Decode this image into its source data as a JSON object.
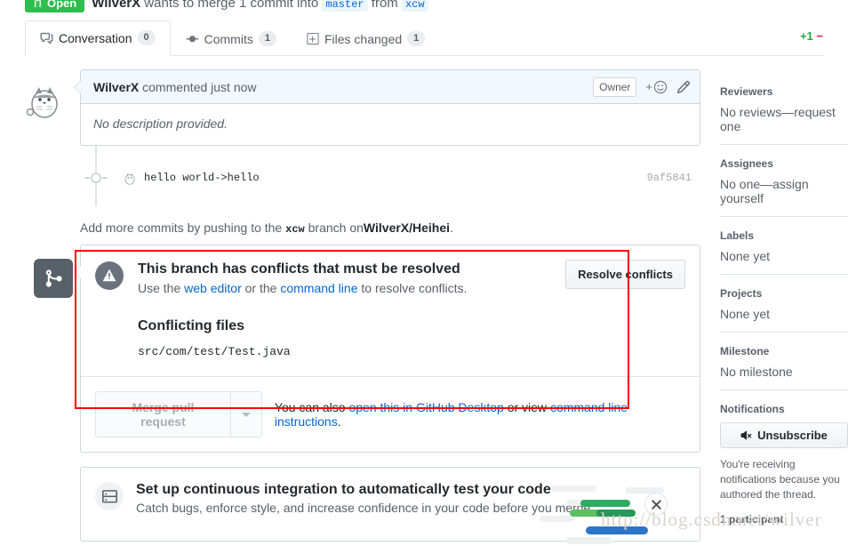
{
  "header": {
    "state": "Open",
    "author": "WilverX",
    "text_wants": "wants to merge",
    "commit_count": "1 commit",
    "into_word": "into",
    "base_branch": "master",
    "from_word": "from",
    "head_branch": "xcw"
  },
  "tabs": [
    {
      "label": "Conversation",
      "count": "0",
      "icon": "comment-discussion-icon",
      "active": true
    },
    {
      "label": "Commits",
      "count": "1",
      "icon": "git-commit-icon",
      "active": false
    },
    {
      "label": "Files changed",
      "count": "1",
      "icon": "diff-icon",
      "active": false
    }
  ],
  "diffstat": {
    "additions": "+1",
    "deletions": "−"
  },
  "comment": {
    "author": "WilverX",
    "action": "commented just now",
    "owner_badge": "Owner",
    "add_reaction": "+",
    "body": "No description provided."
  },
  "commit": {
    "message": "hello world->hello",
    "sha": "9af5841"
  },
  "add_more": {
    "prefix": "Add more commits by pushing to the",
    "branch": "xcw",
    "middle": "branch on",
    "repo": "WilverX/Heihei",
    "suffix": "."
  },
  "conflicts": {
    "title": "This branch has conflicts that must be resolved",
    "sub_prefix": "Use the",
    "link_web_editor": "web editor",
    "sub_middle": "or the",
    "link_command_line": "command line",
    "sub_suffix": "to resolve conflicts.",
    "resolve_button": "Resolve conflicts",
    "files_heading": "Conflicting files",
    "files": [
      "src/com/test/Test.java"
    ]
  },
  "merge": {
    "button_label": "Merge pull request",
    "note_prefix": "You can also",
    "link_desktop": "open this in GitHub Desktop",
    "note_middle": "or view",
    "link_cli": "command line instructions",
    "note_suffix": "."
  },
  "ci_promo": {
    "title": "Set up continuous integration to automatically test your code",
    "subtitle": "Catch bugs, enforce style, and increase confidence in your code before you merge.",
    "dismiss": "✕"
  },
  "sidebar": [
    {
      "title": "Reviewers",
      "value": "No reviews—request one"
    },
    {
      "title": "Assignees",
      "value": "No one—assign yourself"
    },
    {
      "title": "Labels",
      "value": "None yet"
    },
    {
      "title": "Projects",
      "value": "None yet"
    },
    {
      "title": "Milestone",
      "value": "No milestone"
    }
  ],
  "notifications": {
    "title": "Notifications",
    "button": "Unsubscribe",
    "note": "You're receiving notifications because you authored the thread.",
    "participants": "1 participant"
  },
  "watermark": "http://blog.csdn.net/wilver",
  "colors": {
    "open_green": "#2cbe4e",
    "link_blue": "#0366d6",
    "border": "#d1d5da",
    "conflict_gray": "#6a737d",
    "redbox": "#ff0000"
  }
}
